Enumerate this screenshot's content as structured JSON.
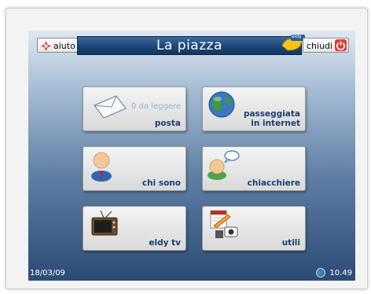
{
  "header": {
    "title": "La piazza",
    "help_label": "aiuto",
    "close_label": "chiudi",
    "badge_text": "eldy"
  },
  "tiles": [
    {
      "label": "posta",
      "sub": "0 da leggere",
      "icon": "envelope-icon"
    },
    {
      "label": "passeggiata in internet",
      "icon": "globe-icon"
    },
    {
      "label": "chi sono",
      "icon": "person-icon"
    },
    {
      "label": "chiacchiere",
      "icon": "chat-person-icon"
    },
    {
      "label": "eldy tv",
      "icon": "tv-icon"
    },
    {
      "label": "utili",
      "icon": "tools-icon"
    }
  ],
  "status": {
    "date": "18/03/09",
    "time": "10.49"
  },
  "colors": {
    "title_bar": "#1d4679",
    "tile_text": "#1b3f73",
    "close_red": "#e23a2e"
  }
}
